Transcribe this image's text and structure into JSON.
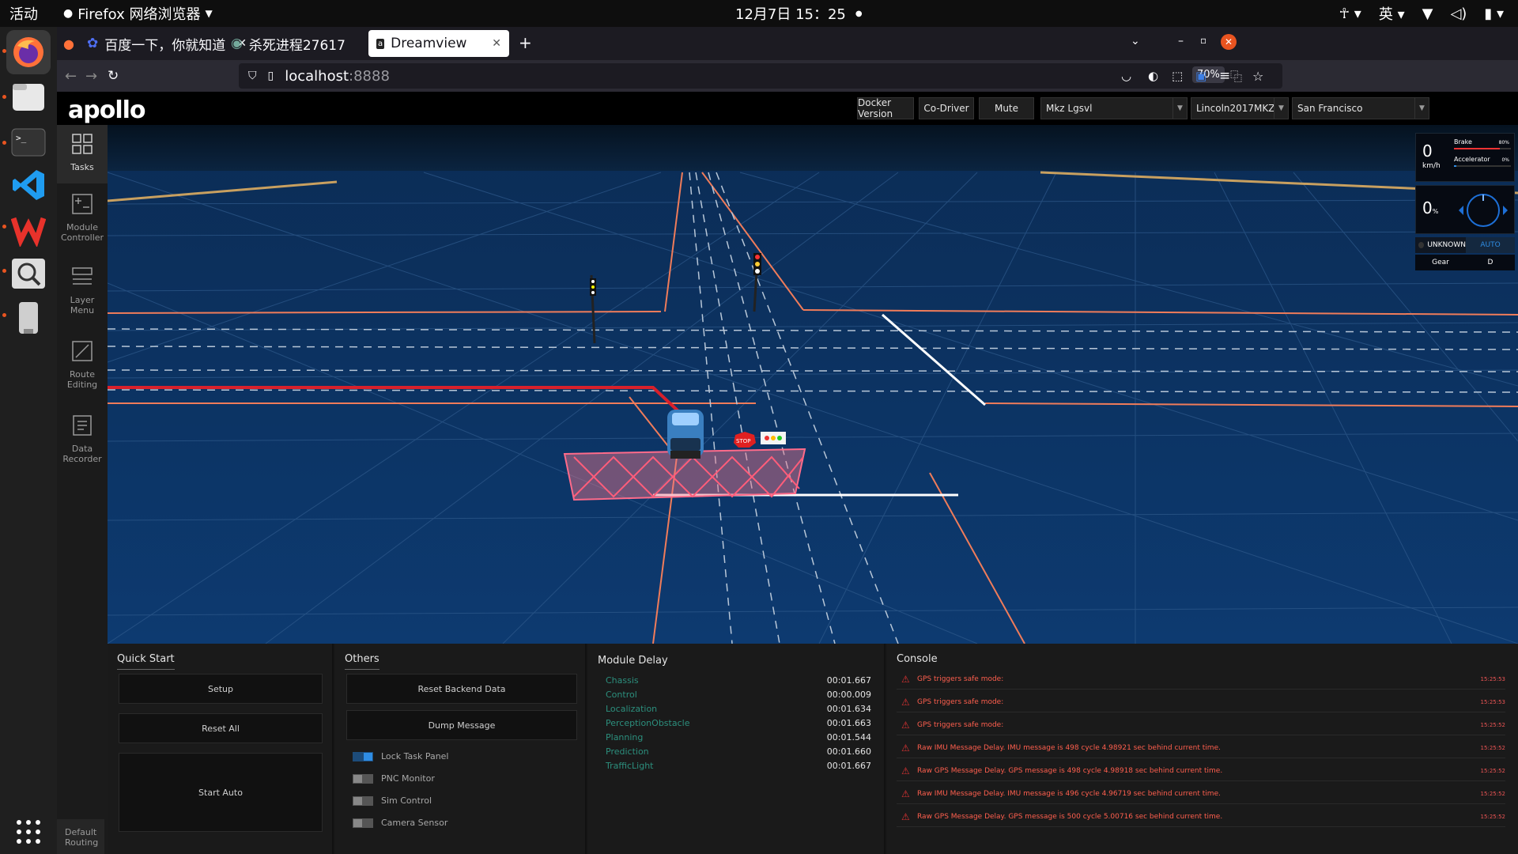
{
  "system": {
    "activities": "活动",
    "app_menu": "Firefox 网络浏览器",
    "clock": "12月7日 15：25",
    "input_method": "英"
  },
  "browser": {
    "tabs": [
      {
        "label": "百度一下，你就知道",
        "active": false
      },
      {
        "label": "杀死进程27617",
        "active": false
      },
      {
        "label": "Dreamview",
        "active": true
      }
    ],
    "url_host": "localhost",
    "url_port": ":8888",
    "zoom": "70%"
  },
  "dreamview": {
    "logo": "apollo",
    "header_buttons": [
      "Docker Version",
      "Co-Driver",
      "Mute"
    ],
    "mode_select": "Mkz Lgsvl",
    "vehicle_select": "Lincoln2017MKZ",
    "map_select": "San Francisco",
    "nav": [
      {
        "label": "Tasks",
        "active": true
      },
      {
        "label": "Module Controller",
        "active": false
      },
      {
        "label": "Layer Menu",
        "active": false
      },
      {
        "label": "Route Editing",
        "active": false
      },
      {
        "label": "Data Recorder",
        "active": false
      },
      {
        "label": "Default Routing",
        "active": false
      }
    ],
    "hud": {
      "speed": "0",
      "speed_unit": "km/h",
      "brake_label": "Brake",
      "brake_value": "80%",
      "accel_label": "Accelerator",
      "accel_value": "0%",
      "steering": "0",
      "steering_unit": "%",
      "signal": "UNKNOWN",
      "drive_mode": "AUTO",
      "gear_label": "Gear",
      "gear_value": "D"
    },
    "scene_labels": {
      "stop": "STOP"
    },
    "quick_start": {
      "title": "Quick Start",
      "buttons": [
        "Setup",
        "Reset All",
        "Start Auto"
      ]
    },
    "others": {
      "title": "Others",
      "buttons": [
        "Reset Backend Data",
        "Dump Message"
      ],
      "toggles": [
        {
          "label": "Lock Task Panel",
          "on": true
        },
        {
          "label": "PNC Monitor",
          "on": false
        },
        {
          "label": "Sim Control",
          "on": false
        },
        {
          "label": "Camera Sensor",
          "on": false
        }
      ]
    },
    "module_delay": {
      "title": "Module Delay",
      "rows": [
        {
          "name": "Chassis",
          "value": "00:01.667"
        },
        {
          "name": "Control",
          "value": "00:00.009"
        },
        {
          "name": "Localization",
          "value": "00:01.634"
        },
        {
          "name": "PerceptionObstacle",
          "value": "00:01.663"
        },
        {
          "name": "Planning",
          "value": "00:01.544"
        },
        {
          "name": "Prediction",
          "value": "00:01.660"
        },
        {
          "name": "TrafficLight",
          "value": "00:01.667"
        }
      ]
    },
    "console": {
      "title": "Console",
      "rows": [
        {
          "msg": "GPS triggers safe mode:",
          "time": "15:25:53"
        },
        {
          "msg": "GPS triggers safe mode:",
          "time": "15:25:53"
        },
        {
          "msg": "GPS triggers safe mode:",
          "time": "15:25:52"
        },
        {
          "msg": "Raw IMU Message Delay. IMU message is 498 cycle 4.98921 sec behind current time.",
          "time": "15:25:52"
        },
        {
          "msg": "Raw GPS Message Delay. GPS message is 498 cycle 4.98918 sec behind current time.",
          "time": "15:25:52"
        },
        {
          "msg": "Raw IMU Message Delay. IMU message is 496 cycle 4.96719 sec behind current time.",
          "time": "15:25:52"
        },
        {
          "msg": "Raw GPS Message Delay. GPS message is 500 cycle 5.00716 sec behind current time.",
          "time": "15:25:52"
        }
      ]
    }
  }
}
